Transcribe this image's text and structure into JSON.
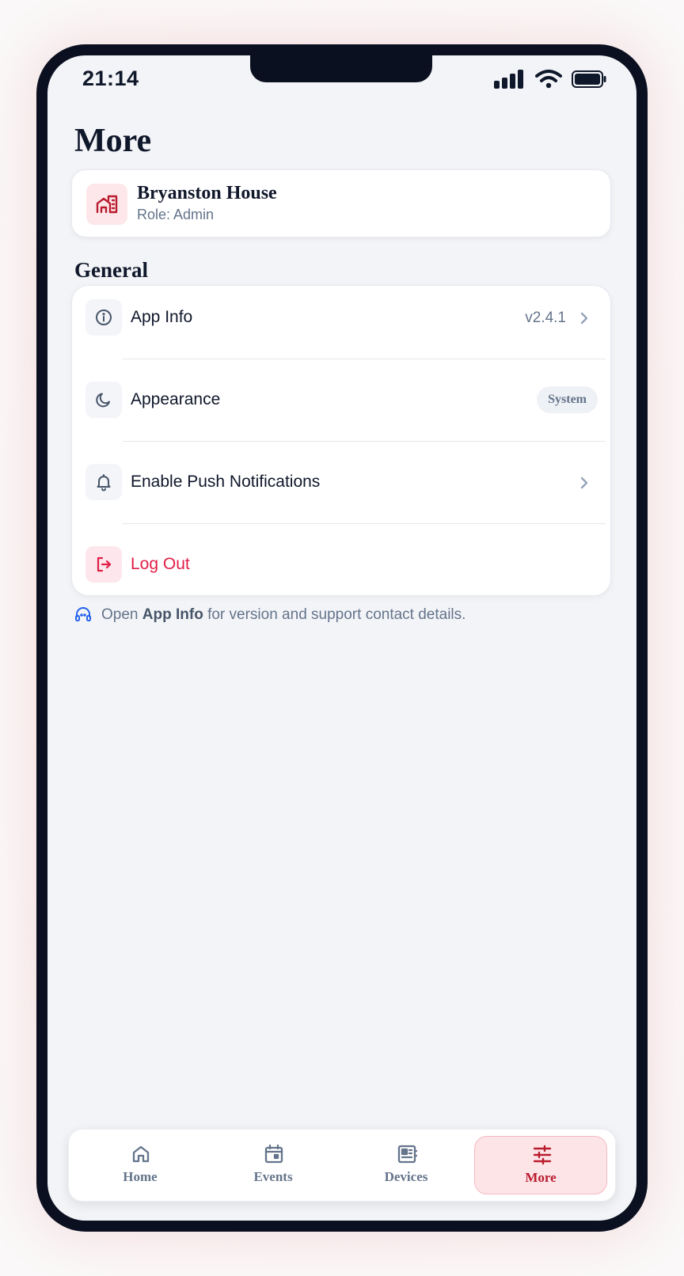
{
  "status_bar": {
    "time": "21:14",
    "icons": [
      "signal-icon",
      "wifi-icon",
      "battery-icon"
    ]
  },
  "page": {
    "title": "More"
  },
  "profile": {
    "icon": "home-building-icon",
    "name": "Bryanston House",
    "role": "Role: Admin"
  },
  "general": {
    "title": "General",
    "items": [
      {
        "icon": "info-icon",
        "label": "App Info",
        "value": "v2.4.1",
        "chevron": true
      },
      {
        "icon": "moon-icon",
        "label": "Appearance",
        "badge": "System"
      },
      {
        "icon": "bell-icon",
        "label": "Enable Push Notifications",
        "chevron": true
      },
      {
        "icon": "logout-icon",
        "label": "Log Out",
        "danger": true
      }
    ]
  },
  "hint": {
    "icon": "support-icon",
    "prefix": "Open",
    "emphasis": "App Info",
    "suffix": "for version and support contact details."
  },
  "tabbar": {
    "tabs": [
      {
        "icon": "home-icon",
        "label": "Home",
        "active": false
      },
      {
        "icon": "calendar-icon",
        "label": "Events",
        "active": false
      },
      {
        "icon": "devices-icon",
        "label": "Devices",
        "active": false
      },
      {
        "icon": "sliders-icon",
        "label": "More",
        "active": true
      }
    ]
  },
  "colors": {
    "accent": "#b91c2e",
    "danger": "#e11d48",
    "text": "#0f172a",
    "muted": "#64748b",
    "background": "#f3f4f7",
    "frame": "#0b1020"
  }
}
